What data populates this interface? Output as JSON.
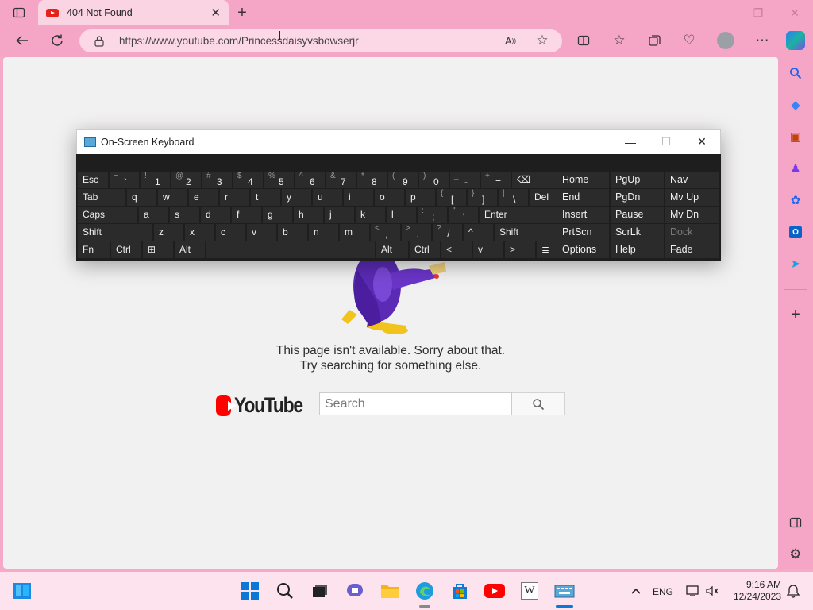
{
  "browser": {
    "tab_title": "404 Not Found",
    "url": "https://www.youtube.com/Princessdaisyvsbowserjr",
    "new_tab_symbol": "+",
    "accent_color": "#f5a6c6"
  },
  "page": {
    "message_line1": "This page isn't available. Sorry about that.",
    "message_line2": "Try searching for something else.",
    "logo_text": "YouTube",
    "search_placeholder": "Search"
  },
  "osk": {
    "title": "On-Screen Keyboard",
    "row1": [
      {
        "label": "Esc"
      },
      {
        "shift": "~",
        "main": "`"
      },
      {
        "shift": "!",
        "main": "1"
      },
      {
        "shift": "@",
        "main": "2"
      },
      {
        "shift": "#",
        "main": "3"
      },
      {
        "shift": "$",
        "main": "4"
      },
      {
        "shift": "%",
        "main": "5"
      },
      {
        "shift": "^",
        "main": "6"
      },
      {
        "shift": "&",
        "main": "7"
      },
      {
        "shift": "*",
        "main": "8"
      },
      {
        "shift": "(",
        "main": "9"
      },
      {
        "shift": ")",
        "main": "0"
      },
      {
        "shift": "_",
        "main": "-"
      },
      {
        "shift": "+",
        "main": "="
      },
      {
        "label": "⌫"
      }
    ],
    "row2": [
      {
        "label": "Tab"
      },
      {
        "label": "q"
      },
      {
        "label": "w"
      },
      {
        "label": "e"
      },
      {
        "label": "r"
      },
      {
        "label": "t"
      },
      {
        "label": "y"
      },
      {
        "label": "u"
      },
      {
        "label": "i"
      },
      {
        "label": "o"
      },
      {
        "label": "p"
      },
      {
        "shift": "{",
        "main": "["
      },
      {
        "shift": "}",
        "main": "]"
      },
      {
        "shift": "|",
        "main": "\\"
      },
      {
        "label": "Del"
      }
    ],
    "row3": [
      {
        "label": "Caps"
      },
      {
        "label": "a"
      },
      {
        "label": "s"
      },
      {
        "label": "d"
      },
      {
        "label": "f"
      },
      {
        "label": "g"
      },
      {
        "label": "h"
      },
      {
        "label": "j"
      },
      {
        "label": "k"
      },
      {
        "label": "l"
      },
      {
        "shift": ":",
        "main": ";"
      },
      {
        "shift": "\"",
        "main": "'"
      },
      {
        "label": "Enter"
      }
    ],
    "row4": [
      {
        "label": "Shift"
      },
      {
        "label": "z"
      },
      {
        "label": "x"
      },
      {
        "label": "c"
      },
      {
        "label": "v"
      },
      {
        "label": "b"
      },
      {
        "label": "n"
      },
      {
        "label": "m"
      },
      {
        "shift": "<",
        "main": ","
      },
      {
        "shift": ">",
        "main": "."
      },
      {
        "shift": "?",
        "main": "/"
      },
      {
        "label": "^"
      },
      {
        "label": "Shift"
      }
    ],
    "row5": [
      {
        "label": "Fn"
      },
      {
        "label": "Ctrl"
      },
      {
        "label": "⊞"
      },
      {
        "label": "Alt"
      },
      {
        "label": ""
      },
      {
        "label": "Alt"
      },
      {
        "label": "Ctrl"
      },
      {
        "label": "<"
      },
      {
        "label": "v"
      },
      {
        "label": ">"
      },
      {
        "label": "≣"
      }
    ],
    "nav": [
      [
        "Home",
        "PgUp",
        "Nav"
      ],
      [
        "End",
        "PgDn",
        "Mv Up"
      ],
      [
        "Insert",
        "Pause",
        "Mv Dn"
      ],
      [
        "PrtScn",
        "ScrLk",
        "Dock"
      ],
      [
        "Options",
        "Help",
        "Fade"
      ]
    ]
  },
  "taskbar": {
    "language": "ENG",
    "time": "9:16 AM",
    "date": "12/24/2023"
  }
}
